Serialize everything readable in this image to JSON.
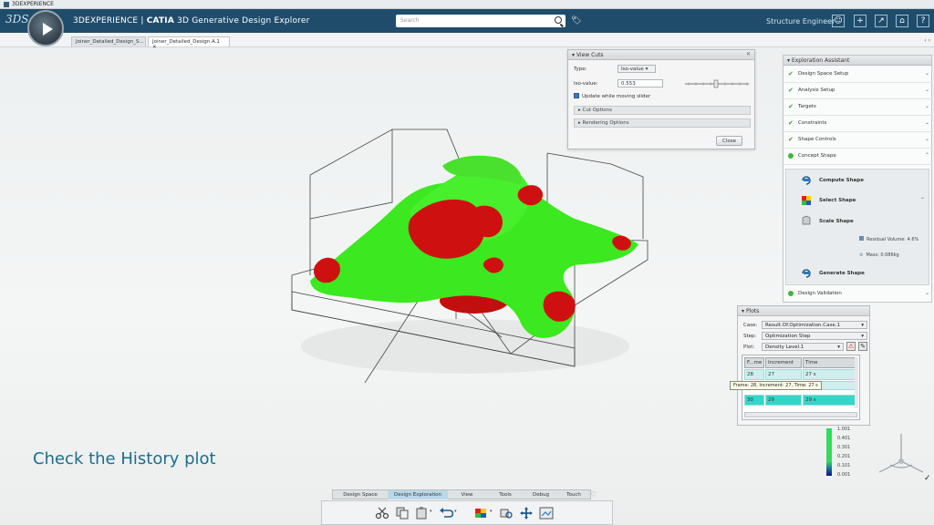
{
  "os_bar": {
    "title": "3DEXPERIENCE"
  },
  "header": {
    "app_prefix": "3DEXPERIENCE | ",
    "app_brand": "CATIA",
    "app_name": " 3D Generative Design Explorer",
    "search_placeholder": "Search",
    "role": "Structure Engineer",
    "buttons": [
      "user-icon",
      "add-icon",
      "share-icon",
      "home-icon",
      "help-icon"
    ]
  },
  "tabs": [
    {
      "label": "Joiner_Detailed_Design_S...",
      "active": false
    },
    {
      "label": "Joiner_Detailed_Design A.1",
      "active": true
    }
  ],
  "view_cuts": {
    "title": "View Cuts",
    "type_label": "Type:",
    "type_value": "Iso-value",
    "iso_label": "Iso-value:",
    "iso_value": "0.553",
    "update_label": "Update while moving slider",
    "cut_options": "Cut Options",
    "rendering_options": "Rendering Options",
    "close_label": "Close"
  },
  "assistant": {
    "title": "Exploration Assistant",
    "steps": [
      {
        "label": "Design Space Setup",
        "status": "done"
      },
      {
        "label": "Analysis Setup",
        "status": "done"
      },
      {
        "label": "Targets",
        "status": "done"
      },
      {
        "label": "Constraints",
        "status": "done"
      },
      {
        "label": "Shape Controls",
        "status": "done"
      },
      {
        "label": "Concept Shape",
        "status": "current"
      }
    ],
    "concept": {
      "compute": "Compute Shape",
      "select": "Select Shape",
      "scale": "Scale Shape",
      "residual": "Residual Volume: 4.6%",
      "mass": "Mass: 0.086kg",
      "generate": "Generate Shape"
    },
    "validation": "Design Validation"
  },
  "plots": {
    "title": "Plots",
    "case_label": "Case:",
    "case_value": "Result.Of.Optimization.Case.1",
    "step_label": "Step:",
    "step_value": "Optimization Step",
    "plot_label": "Plot:",
    "plot_value": "Density Level.1",
    "columns": [
      "F...me",
      "Increment",
      "Time"
    ],
    "rows": [
      [
        "28",
        "27",
        "27 s"
      ],
      [
        "30",
        "29",
        "29 s"
      ]
    ],
    "tooltip": "Frame: 28, Increment: 27, Time: 27 s"
  },
  "legend": {
    "values": [
      "1.001",
      "0.401",
      "0.301",
      "0.201",
      "0.101",
      "0.001"
    ]
  },
  "caption": "Check the History plot",
  "toolbar": {
    "tabs": [
      "Design Space",
      "Design Exploration",
      "View",
      "Tools",
      "Debug",
      "Touch"
    ],
    "active_tab": "Design Exploration",
    "icons": [
      "cut-icon",
      "copy-icon",
      "paste-icon",
      "undo-icon",
      "shape-icon",
      "simulate-icon",
      "move-icon",
      "image-icon"
    ]
  },
  "colors": {
    "header": "#1f4c6b",
    "shape_green": "#3ce81f",
    "shape_red": "#d01212",
    "row_highlight": "#33d7c8",
    "caption": "#1c6d8b"
  }
}
